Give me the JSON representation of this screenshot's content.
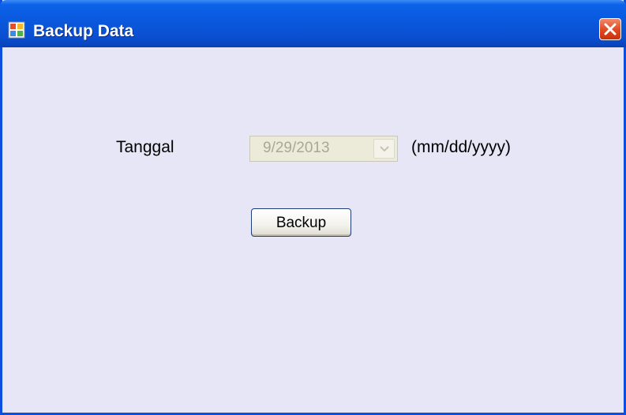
{
  "window": {
    "title": "Backup Data",
    "icon": "application-icon",
    "close_icon": "close-icon"
  },
  "form": {
    "date_label": "Tanggal",
    "date_value": "9/29/2013",
    "date_format_hint": "(mm/dd/yyyy)",
    "date_picker_enabled": false,
    "dropdown_icon": "chevron-down-icon"
  },
  "actions": {
    "backup_label": "Backup"
  },
  "colors": {
    "titlebar": "#0a58dd",
    "window_border": "#0a4fe0",
    "client_background": "#e7e6f7",
    "close_button": "#e0461f"
  }
}
